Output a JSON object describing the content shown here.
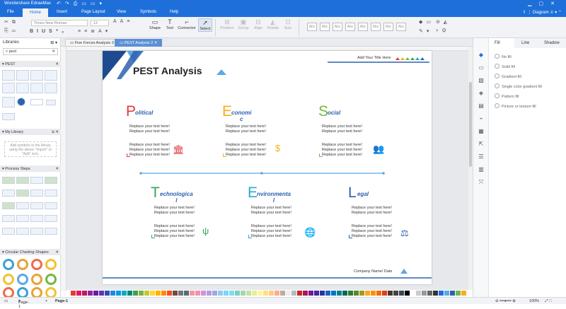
{
  "app": {
    "title": "Wondershare EdrawMax",
    "user": "Diagram"
  },
  "menu": [
    "File",
    "Home",
    "Insert",
    "Page Layout",
    "View",
    "Symbols",
    "Help"
  ],
  "menu_active": "Home",
  "ribbon": {
    "font_name": "Times New Roman",
    "font_size": "12",
    "tools": [
      "Shape",
      "Text",
      "Connector",
      "Select"
    ],
    "disabled_tools": [
      "Position",
      "Group",
      "Align",
      "Rotate",
      "Size"
    ],
    "style_label": "Abc"
  },
  "left_panel": {
    "title": "Libraries",
    "search_value": "pest",
    "sections": [
      "PEST",
      "My Library",
      "Process Steps",
      "Circular Charting Shapes"
    ],
    "my_library_note": "Add symbols to the library using the above \"Import\" or \"Add\" icon."
  },
  "doc_tabs": [
    "Five Forces Analysis 3",
    "PEST Analysis 2"
  ],
  "doc_tab_active": 1,
  "page": {
    "title": "PEST Analysis",
    "add_title": "Add Your Title Here",
    "company": "Company Name/ Date",
    "placeholder": "Replace your text here!",
    "items": [
      {
        "letter": "P",
        "rest": "olitical",
        "color": "#e0393e",
        "icon": "bank-icon"
      },
      {
        "letter": "E",
        "rest": "conomi\nc",
        "color": "#f5b01a",
        "icon": "dollar-icon"
      },
      {
        "letter": "S",
        "rest": "ocial",
        "color": "#74b743",
        "icon": "people-icon"
      },
      {
        "letter": "T",
        "rest": "echnologica\nl",
        "color": "#3aa35b",
        "icon": "usb-icon"
      },
      {
        "letter": "E",
        "rest": "nvironmenta\nl",
        "color": "#2ba6d9",
        "icon": "globe-icon"
      },
      {
        "letter": "L",
        "rest": "egal",
        "color": "#2d62b0",
        "icon": "scale-icon"
      }
    ]
  },
  "right_panel": {
    "tabs": [
      "Fill",
      "Line",
      "Shadow"
    ],
    "active_tab": "Fill",
    "options": [
      "No fill",
      "Solid fill",
      "Gradient fill",
      "Single color gradient fill",
      "Pattern fill",
      "Picture or texture fill"
    ]
  },
  "status": {
    "page_selector": "Page-1",
    "page_tab": "Page-1",
    "zoom": "100%"
  },
  "colors": {
    "accent": "#1e6fd9",
    "title_line": "#2d62b0",
    "triangle": "#5aa9e6"
  }
}
